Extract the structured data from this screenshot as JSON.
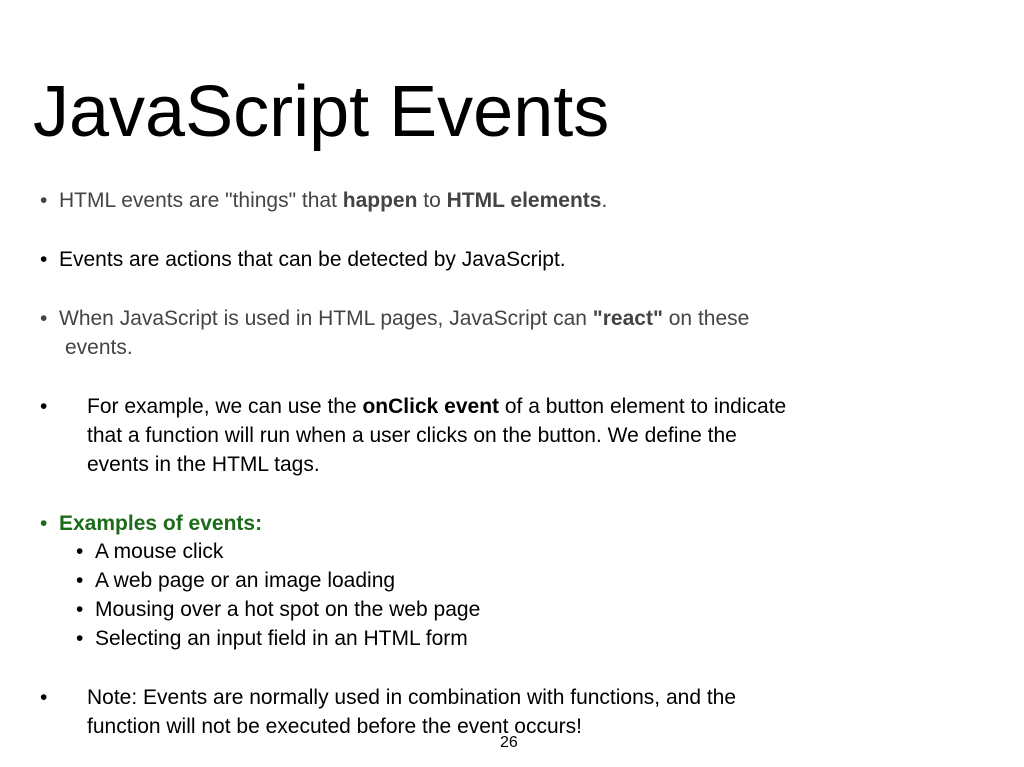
{
  "slide": {
    "title": "JavaScript Events",
    "page_number": "26"
  },
  "bullets": {
    "b1": {
      "pre": "HTML events are \"things\" that ",
      "bold1": "happen",
      "mid": " to ",
      "bold2": "HTML elements",
      "post": "."
    },
    "b2": {
      "text": "Events are actions that can be detected by JavaScript."
    },
    "b3": {
      "pre": "When JavaScript is used in HTML pages, JavaScript can ",
      "bold": "\"react\"",
      "post": " on these",
      "line2": "events."
    },
    "b4": {
      "pre": "For example, we can use the ",
      "bold": "onClick event",
      "post": " of a button element to indicate",
      "line2": "that  a function will run when a user clicks on the button. We define the",
      "line3": "events in  the HTML tags."
    },
    "b5": {
      "heading": "Examples of events:",
      "items": [
        "A mouse click",
        "A web page or an image loading",
        "Mousing over a hot spot on the web page",
        "Selecting an input field in an HTML form"
      ]
    },
    "b6": {
      "line1": "Note: Events are normally used in combination with functions, and the",
      "line2": "function  will not be executed before the event occurs!"
    }
  },
  "colors": {
    "title": "#000000",
    "gray_text": "#444444",
    "green_heading": "#1b6b1b"
  }
}
